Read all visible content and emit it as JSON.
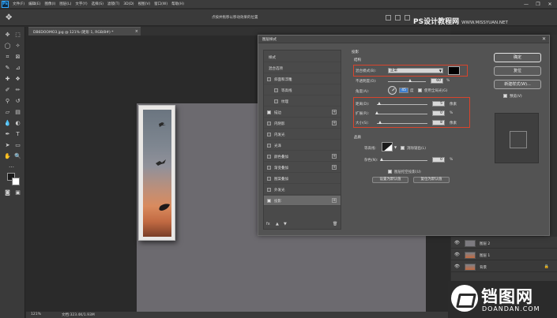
{
  "app": {
    "logo": "Ps",
    "menu": [
      "文件(F)",
      "编辑(E)",
      "图像(I)",
      "图层(L)",
      "文字(Y)",
      "选择(S)",
      "滤镜(T)",
      "3D(D)",
      "视图(V)",
      "窗口(W)",
      "帮助(H)"
    ],
    "window_controls": [
      "—",
      "❐",
      "✕"
    ]
  },
  "options_bar": {
    "hint": "点按并拖移以移动效果的位置",
    "watermark": "PS设计教程网",
    "watermark_sub": "WWW.MISSYUAN.NET"
  },
  "document": {
    "tab_label": "DB6DOOMO3.jpg @ 121% (矩形 1, RGB/8#) *",
    "close": "×",
    "zoom": "121%",
    "doc_info": "文档:323.4K/1.93M"
  },
  "layers": [
    {
      "name": "图层 2",
      "thumb": "gray",
      "lock": ""
    },
    {
      "name": "图层 1",
      "thumb": "photo",
      "lock": ""
    },
    {
      "name": "背景",
      "thumb": "photo",
      "lock": "🔒"
    }
  ],
  "layer_style_dialog": {
    "title": "图层样式",
    "close": "✕",
    "list": [
      {
        "label": "样式",
        "type": "head",
        "checked": false,
        "plus": false,
        "active": false
      },
      {
        "label": "混合选项",
        "type": "head",
        "checked": false,
        "plus": false,
        "active": false
      },
      {
        "label": "斜面和浮雕",
        "type": "item",
        "checked": false,
        "plus": false,
        "active": false
      },
      {
        "label": "等高线",
        "type": "sub",
        "checked": false,
        "plus": false,
        "active": false
      },
      {
        "label": "纹理",
        "type": "sub",
        "checked": false,
        "plus": false,
        "active": false
      },
      {
        "label": "描边",
        "type": "item",
        "checked": true,
        "plus": true,
        "active": false
      },
      {
        "label": "内阴影",
        "type": "item",
        "checked": false,
        "plus": true,
        "active": false
      },
      {
        "label": "内发光",
        "type": "item",
        "checked": false,
        "plus": false,
        "active": false
      },
      {
        "label": "光泽",
        "type": "item",
        "checked": false,
        "plus": false,
        "active": false
      },
      {
        "label": "颜色叠加",
        "type": "item",
        "checked": false,
        "plus": true,
        "active": false
      },
      {
        "label": "渐变叠加",
        "type": "item",
        "checked": false,
        "plus": true,
        "active": false
      },
      {
        "label": "图案叠加",
        "type": "item",
        "checked": false,
        "plus": false,
        "active": false
      },
      {
        "label": "外发光",
        "type": "item",
        "checked": false,
        "plus": false,
        "active": false
      },
      {
        "label": "投影",
        "type": "item",
        "checked": true,
        "plus": true,
        "active": true
      }
    ],
    "list_footer": [
      "fx",
      "▲",
      "▼",
      "🗑"
    ],
    "drop_shadow": {
      "section": "投影",
      "structure": "结构",
      "blend_mode_label": "混合模式(B):",
      "blend_mode": "正常",
      "shadow_color": "#000000",
      "opacity_label": "不透明度(O):",
      "opacity": "60",
      "opacity_level": 0.6,
      "angle_label": "角度(A):",
      "angle": "45",
      "angle_unit": "度",
      "global_light": "使用全局光(G)",
      "distance_label": "距离(D):",
      "distance": "5",
      "spread_label": "扩展(R):",
      "spread": "0",
      "size_label": "大小(S):",
      "size": "8",
      "px": "像素",
      "percent": "%",
      "quality": "品质",
      "contour_label": "等高线:",
      "anti_alias": "消除锯齿(L)",
      "noise_label": "杂色(N):",
      "noise": "0",
      "knockout": "图层挖空投影(U)",
      "make_default": "设置为默认值",
      "reset_default": "复位为默认值"
    },
    "buttons": {
      "ok": "确定",
      "reset": "复位",
      "new_style": "新建样式(W)...",
      "preview": "预览(V)"
    }
  },
  "bottom_watermark": {
    "cn": "铛图网",
    "en": "DOANDAN.COM"
  },
  "colors": {
    "red_box": "#d8442c",
    "ps_blue": "#31a8ff"
  }
}
